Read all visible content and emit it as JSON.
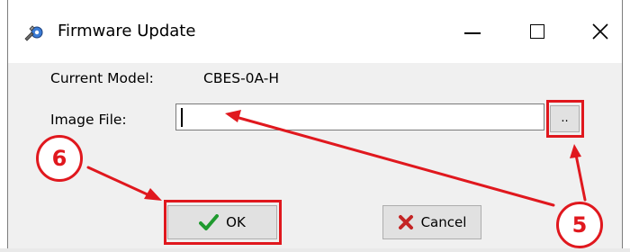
{
  "window": {
    "title": "Firmware Update",
    "icon": "wrench-gear-icon",
    "controls": [
      "minimize-icon",
      "maximize-icon",
      "close-icon"
    ]
  },
  "form": {
    "current_model_label": "Current Model:",
    "current_model_value": "CBES-0A-H",
    "image_file_label": "Image File:",
    "image_file_value": "",
    "browse_label": ".."
  },
  "buttons": {
    "ok_label": "OK",
    "ok_icon": "checkmark-icon",
    "cancel_label": "Cancel",
    "cancel_icon": "x-mark-icon"
  },
  "annotations": {
    "step_6": "6",
    "step_5": "5",
    "color": "#e0181e"
  }
}
